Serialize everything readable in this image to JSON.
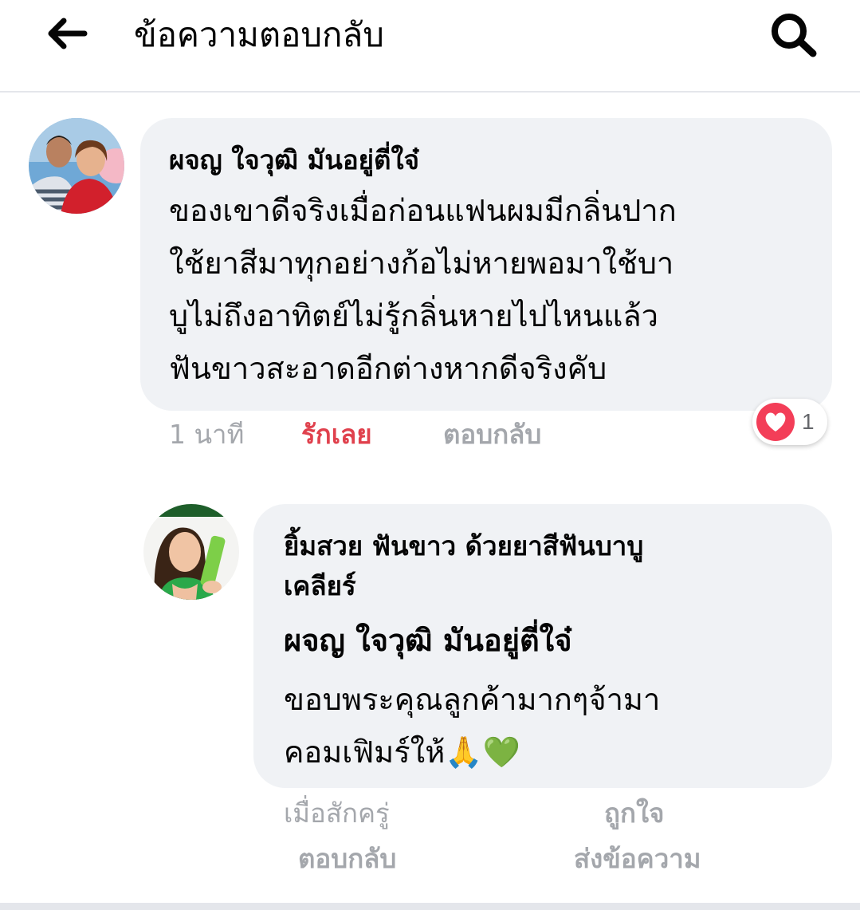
{
  "header": {
    "title": "ข้อความตอบกลับ",
    "back_icon": "arrow-left-icon",
    "search_icon": "search-icon"
  },
  "comment": {
    "author": "ผจญ ใจวุฒิ มันอยู่ตี่ใจ๋",
    "lines": [
      "ของเขาดีจริงเมื่อก่อนแฟนผมมีกลิ่นปาก",
      "ใช้ยาสีมาทุกอย่างก้อไม่หายพอมาใช้บา",
      "บูไม่ถึงอาทิตย์ไม่รู้กลิ่นหายไปไหนแล้ว",
      "ฟันขาวสะอาดอีกต่างหากดีจริงคับ"
    ],
    "time": "1 นาที",
    "love_label": "รักเลย",
    "reply_label": "ตอบกลับ",
    "reaction_icon": "heart-icon",
    "reaction_count": "1"
  },
  "reply": {
    "page_name_line1": "ยิ้มสวย ฟันขาว ด้วยยาสีฟันบาบู",
    "page_name_line2": "เคลียร์",
    "mention": "ผจญ ใจวุฒิ มันอยู่ตี่ใจ๋",
    "lines": [
      "ขอบพระคุณลูกค้ามากๆจ้ามา",
      "คอมเฟิมร์ให้"
    ],
    "emoji": "🙏💚",
    "time": "เมื่อสักครู่",
    "like_label": "ถูกใจ",
    "reply_label": "ตอบกลับ",
    "message_label": "ส่งข้อความ"
  },
  "colors": {
    "bubble": "#f0f2f5",
    "love": "#e0414d",
    "meta": "#a4a7ac",
    "heart": "#f33e58"
  }
}
